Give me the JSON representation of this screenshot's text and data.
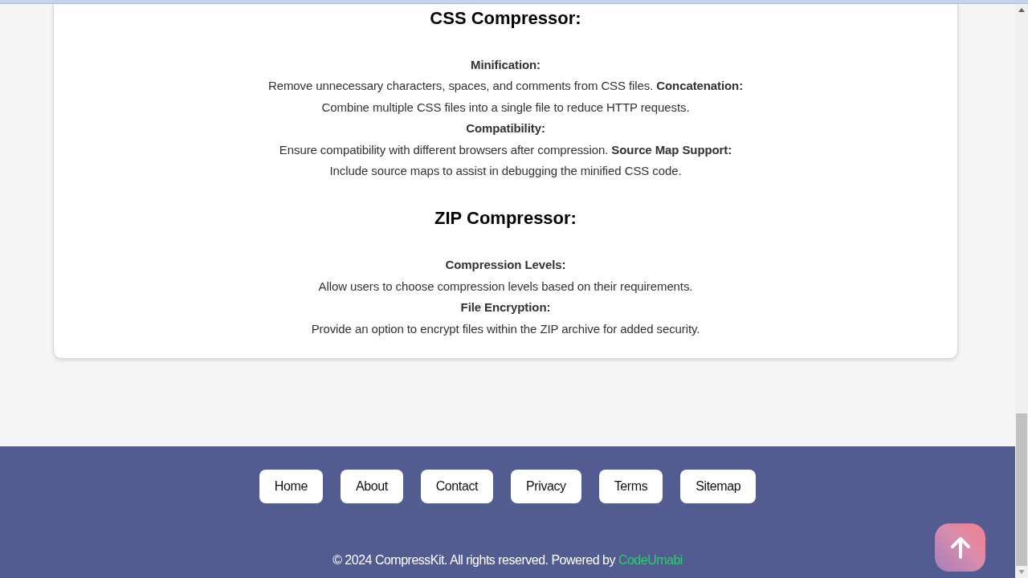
{
  "sections": [
    {
      "title": "CSS Compressor:",
      "paragraph": "**Minification:**\nRemove unnecessary characters, spaces, and comments from CSS files. **Concatenation:**\nCombine multiple CSS files into a single file to reduce HTTP requests.\n**Compatibility:**\nEnsure compatibility with different browsers after compression. **Source Map Support:**\nInclude source maps to assist in debugging the minified CSS code."
    },
    {
      "title": "ZIP Compressor:",
      "paragraph": "**Compression Levels:**\nAllow users to choose compression levels based on their requirements.\n**File Encryption:**\nProvide an option to encrypt files within the ZIP archive for added security."
    }
  ],
  "footer": {
    "links": [
      "Home",
      "About",
      "Contact",
      "Privacy",
      "Terms",
      "Sitemap"
    ],
    "copyright": "© 2024 CompressKit. All rights reserved. Powered by",
    "credit_link": "CodeUmabi"
  }
}
